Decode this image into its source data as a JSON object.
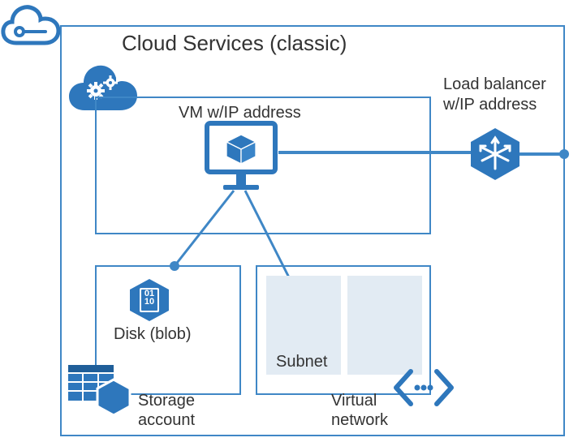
{
  "colors": {
    "azure_blue": "#2e77bc",
    "azure_blue_light": "#4d93d9",
    "border_blue": "#3f87c6",
    "subnet_fill": "#e2ebf3",
    "white": "#ffffff"
  },
  "title": "Cloud Services (classic)",
  "vm": {
    "label": "VM w/IP address"
  },
  "load_balancer": {
    "label_line1": "Load balancer",
    "label_line2": "w/IP address"
  },
  "disk": {
    "label": "Disk (blob)"
  },
  "storage": {
    "label_line1": "Storage",
    "label_line2": "account"
  },
  "subnet": {
    "label": "Subnet"
  },
  "vnet": {
    "label_line1": "Virtual",
    "label_line2": "network"
  }
}
